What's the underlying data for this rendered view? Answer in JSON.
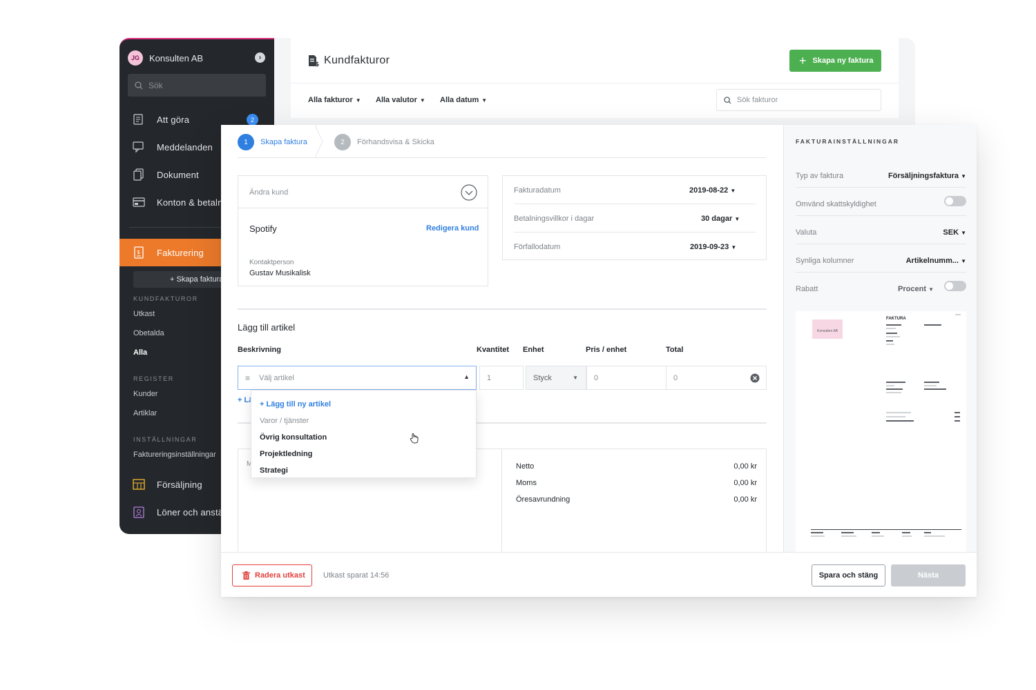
{
  "sidebar": {
    "avatar_initials": "JG",
    "org_name": "Konsulten AB",
    "search_placeholder": "Sök",
    "nav": [
      {
        "label": "Att göra",
        "icon": "checklist-icon",
        "badge": "2"
      },
      {
        "label": "Meddelanden",
        "icon": "chat-icon"
      },
      {
        "label": "Dokument",
        "icon": "documents-icon"
      },
      {
        "label": "Konton & betalningar",
        "icon": "bank-card-icon"
      }
    ],
    "active_nav": {
      "label": "Fakturering",
      "icon": "invoice-icon"
    },
    "create_invoice": "+ Skapa faktura",
    "sections": [
      {
        "title": "KUNDFAKTUROR",
        "items": [
          "Utkast",
          "Obetalda",
          "Alla"
        ]
      },
      {
        "title": "REGISTER",
        "items": [
          "Kunder",
          "Artiklar"
        ]
      },
      {
        "title": "INSTÄLLNINGAR",
        "items": [
          "Faktureringsinställningar"
        ]
      }
    ],
    "bottom_nav": [
      {
        "label": "Försäljning",
        "icon": "sales-chart-icon"
      },
      {
        "label": "Löner och anställda",
        "icon": "employee-badge-icon"
      }
    ]
  },
  "header": {
    "title": "Kundfakturor",
    "new_invoice": "Skapa ny faktura",
    "filters": [
      "Alla fakturor",
      "Alla valutor",
      "Alla datum"
    ],
    "search_placeholder": "Sök fakturor"
  },
  "steps": [
    {
      "num": "1",
      "label": "Skapa faktura"
    },
    {
      "num": "2",
      "label": "Förhandsvisa & Skicka"
    }
  ],
  "customer": {
    "change_placeholder": "Ändra kund",
    "name": "Spotify",
    "edit_link": "Redigera kund",
    "contact_label": "Kontaktperson",
    "contact_name": "Gustav Musikalisk"
  },
  "dates": [
    {
      "label": "Fakturadatum",
      "value": "2019-08-22"
    },
    {
      "label": "Betalningsvillkor i dagar",
      "value": "30 dagar"
    },
    {
      "label": "Förfallodatum",
      "value": "2019-09-23"
    }
  ],
  "articles": {
    "title": "Lägg till artikel",
    "columns": [
      "Beskrivning",
      "Kvantitet",
      "Enhet",
      "Pris / enhet",
      "Total"
    ],
    "row": {
      "description_placeholder": "Välj artikel",
      "quantity": "1",
      "unit": "Styck",
      "price": "0",
      "total": "0"
    },
    "add_link": "+ Lä",
    "dropdown": {
      "add_new": "+ Lägg till ny artikel",
      "group": "Varor / tjänster",
      "options": [
        "Övrig konsultation",
        "Projektledning",
        "Strategi"
      ]
    },
    "notes_placeholder": "M"
  },
  "summary": [
    {
      "label": "Netto",
      "value": "0,00 kr"
    },
    {
      "label": "Moms",
      "value": "0,00 kr"
    },
    {
      "label": "Öresavrundning",
      "value": "0,00 kr"
    }
  ],
  "footer": {
    "delete_draft": "Radera utkast",
    "saved_status": "Utkast sparat 14:56",
    "save_close": "Spara och stäng",
    "next": "Nästa"
  },
  "settings": {
    "title": "FAKTURAINSTÄLLNINGAR",
    "rows": [
      {
        "label": "Typ av faktura",
        "value": "Försäljningsfaktura"
      },
      {
        "label": "Omvänd skattskyldighet",
        "toggle": false
      },
      {
        "label": "Valuta",
        "value": "SEK"
      },
      {
        "label": "Synliga kolumner",
        "value": "Artikelnumm..."
      },
      {
        "label": "Rabatt",
        "value": "Procent",
        "toggle": false
      }
    ]
  },
  "preview": {
    "logo_text": "Konsulten AB",
    "heading": "FAKTURA"
  },
  "colors": {
    "accent_blue": "#2f7fe0",
    "brand_orange": "#ec7a2a",
    "success_green": "#4caf50",
    "danger_red": "#e0403a",
    "sidebar_bg": "#24272b"
  }
}
